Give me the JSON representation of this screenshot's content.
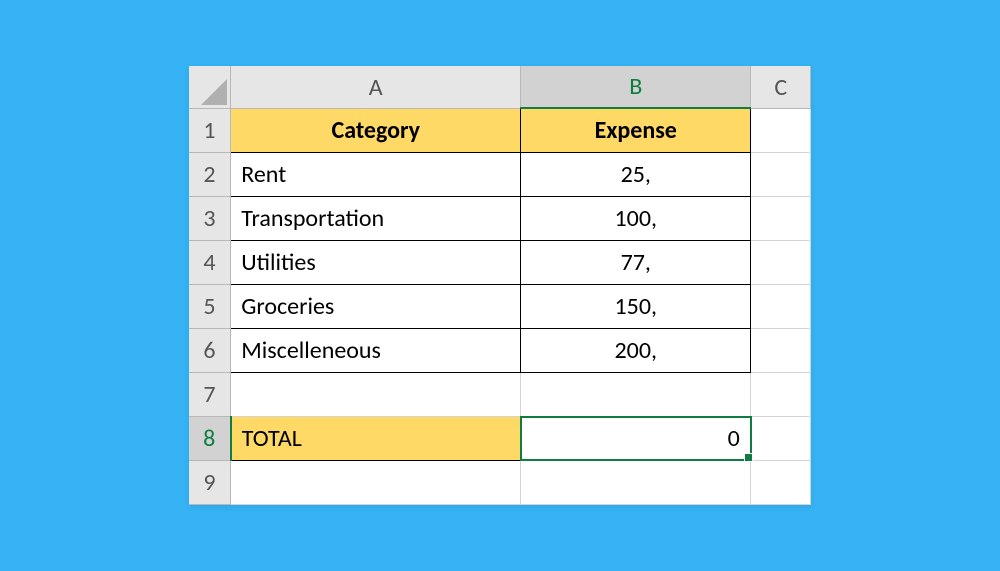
{
  "columns": {
    "A": "A",
    "B": "B",
    "C": "C"
  },
  "row_numbers": [
    "1",
    "2",
    "3",
    "4",
    "5",
    "6",
    "7",
    "8",
    "9"
  ],
  "headers": {
    "category": "Category",
    "expense": "Expense"
  },
  "rows": [
    {
      "category": "Rent",
      "expense": "25,"
    },
    {
      "category": "Transportation",
      "expense": "100,"
    },
    {
      "category": "Utilities",
      "expense": "77,"
    },
    {
      "category": "Groceries",
      "expense": "150,"
    },
    {
      "category": "Miscelleneous",
      "expense": "200,"
    }
  ],
  "total": {
    "label": "TOTAL",
    "value": "0"
  },
  "active_cell": "B8",
  "colors": {
    "highlight": "#ffd966",
    "selection": "#107c41"
  }
}
